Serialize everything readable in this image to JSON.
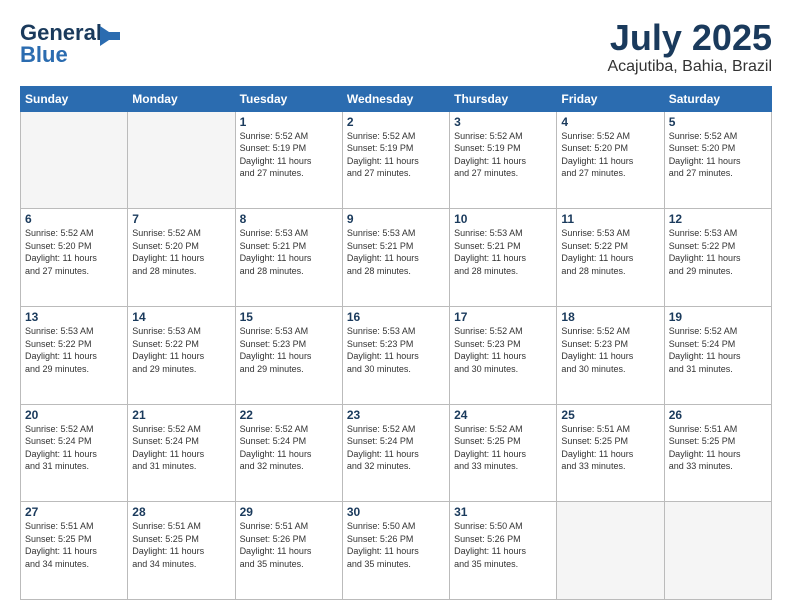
{
  "header": {
    "logo_line1": "General",
    "logo_line2": "Blue",
    "month": "July 2025",
    "location": "Acajutiba, Bahia, Brazil"
  },
  "weekdays": [
    "Sunday",
    "Monday",
    "Tuesday",
    "Wednesday",
    "Thursday",
    "Friday",
    "Saturday"
  ],
  "weeks": [
    [
      {
        "day": "",
        "info": ""
      },
      {
        "day": "",
        "info": ""
      },
      {
        "day": "1",
        "info": "Sunrise: 5:52 AM\nSunset: 5:19 PM\nDaylight: 11 hours\nand 27 minutes."
      },
      {
        "day": "2",
        "info": "Sunrise: 5:52 AM\nSunset: 5:19 PM\nDaylight: 11 hours\nand 27 minutes."
      },
      {
        "day": "3",
        "info": "Sunrise: 5:52 AM\nSunset: 5:19 PM\nDaylight: 11 hours\nand 27 minutes."
      },
      {
        "day": "4",
        "info": "Sunrise: 5:52 AM\nSunset: 5:20 PM\nDaylight: 11 hours\nand 27 minutes."
      },
      {
        "day": "5",
        "info": "Sunrise: 5:52 AM\nSunset: 5:20 PM\nDaylight: 11 hours\nand 27 minutes."
      }
    ],
    [
      {
        "day": "6",
        "info": "Sunrise: 5:52 AM\nSunset: 5:20 PM\nDaylight: 11 hours\nand 27 minutes."
      },
      {
        "day": "7",
        "info": "Sunrise: 5:52 AM\nSunset: 5:20 PM\nDaylight: 11 hours\nand 28 minutes."
      },
      {
        "day": "8",
        "info": "Sunrise: 5:53 AM\nSunset: 5:21 PM\nDaylight: 11 hours\nand 28 minutes."
      },
      {
        "day": "9",
        "info": "Sunrise: 5:53 AM\nSunset: 5:21 PM\nDaylight: 11 hours\nand 28 minutes."
      },
      {
        "day": "10",
        "info": "Sunrise: 5:53 AM\nSunset: 5:21 PM\nDaylight: 11 hours\nand 28 minutes."
      },
      {
        "day": "11",
        "info": "Sunrise: 5:53 AM\nSunset: 5:22 PM\nDaylight: 11 hours\nand 28 minutes."
      },
      {
        "day": "12",
        "info": "Sunrise: 5:53 AM\nSunset: 5:22 PM\nDaylight: 11 hours\nand 29 minutes."
      }
    ],
    [
      {
        "day": "13",
        "info": "Sunrise: 5:53 AM\nSunset: 5:22 PM\nDaylight: 11 hours\nand 29 minutes."
      },
      {
        "day": "14",
        "info": "Sunrise: 5:53 AM\nSunset: 5:22 PM\nDaylight: 11 hours\nand 29 minutes."
      },
      {
        "day": "15",
        "info": "Sunrise: 5:53 AM\nSunset: 5:23 PM\nDaylight: 11 hours\nand 29 minutes."
      },
      {
        "day": "16",
        "info": "Sunrise: 5:53 AM\nSunset: 5:23 PM\nDaylight: 11 hours\nand 30 minutes."
      },
      {
        "day": "17",
        "info": "Sunrise: 5:52 AM\nSunset: 5:23 PM\nDaylight: 11 hours\nand 30 minutes."
      },
      {
        "day": "18",
        "info": "Sunrise: 5:52 AM\nSunset: 5:23 PM\nDaylight: 11 hours\nand 30 minutes."
      },
      {
        "day": "19",
        "info": "Sunrise: 5:52 AM\nSunset: 5:24 PM\nDaylight: 11 hours\nand 31 minutes."
      }
    ],
    [
      {
        "day": "20",
        "info": "Sunrise: 5:52 AM\nSunset: 5:24 PM\nDaylight: 11 hours\nand 31 minutes."
      },
      {
        "day": "21",
        "info": "Sunrise: 5:52 AM\nSunset: 5:24 PM\nDaylight: 11 hours\nand 31 minutes."
      },
      {
        "day": "22",
        "info": "Sunrise: 5:52 AM\nSunset: 5:24 PM\nDaylight: 11 hours\nand 32 minutes."
      },
      {
        "day": "23",
        "info": "Sunrise: 5:52 AM\nSunset: 5:24 PM\nDaylight: 11 hours\nand 32 minutes."
      },
      {
        "day": "24",
        "info": "Sunrise: 5:52 AM\nSunset: 5:25 PM\nDaylight: 11 hours\nand 33 minutes."
      },
      {
        "day": "25",
        "info": "Sunrise: 5:51 AM\nSunset: 5:25 PM\nDaylight: 11 hours\nand 33 minutes."
      },
      {
        "day": "26",
        "info": "Sunrise: 5:51 AM\nSunset: 5:25 PM\nDaylight: 11 hours\nand 33 minutes."
      }
    ],
    [
      {
        "day": "27",
        "info": "Sunrise: 5:51 AM\nSunset: 5:25 PM\nDaylight: 11 hours\nand 34 minutes."
      },
      {
        "day": "28",
        "info": "Sunrise: 5:51 AM\nSunset: 5:25 PM\nDaylight: 11 hours\nand 34 minutes."
      },
      {
        "day": "29",
        "info": "Sunrise: 5:51 AM\nSunset: 5:26 PM\nDaylight: 11 hours\nand 35 minutes."
      },
      {
        "day": "30",
        "info": "Sunrise: 5:50 AM\nSunset: 5:26 PM\nDaylight: 11 hours\nand 35 minutes."
      },
      {
        "day": "31",
        "info": "Sunrise: 5:50 AM\nSunset: 5:26 PM\nDaylight: 11 hours\nand 35 minutes."
      },
      {
        "day": "",
        "info": ""
      },
      {
        "day": "",
        "info": ""
      }
    ]
  ]
}
